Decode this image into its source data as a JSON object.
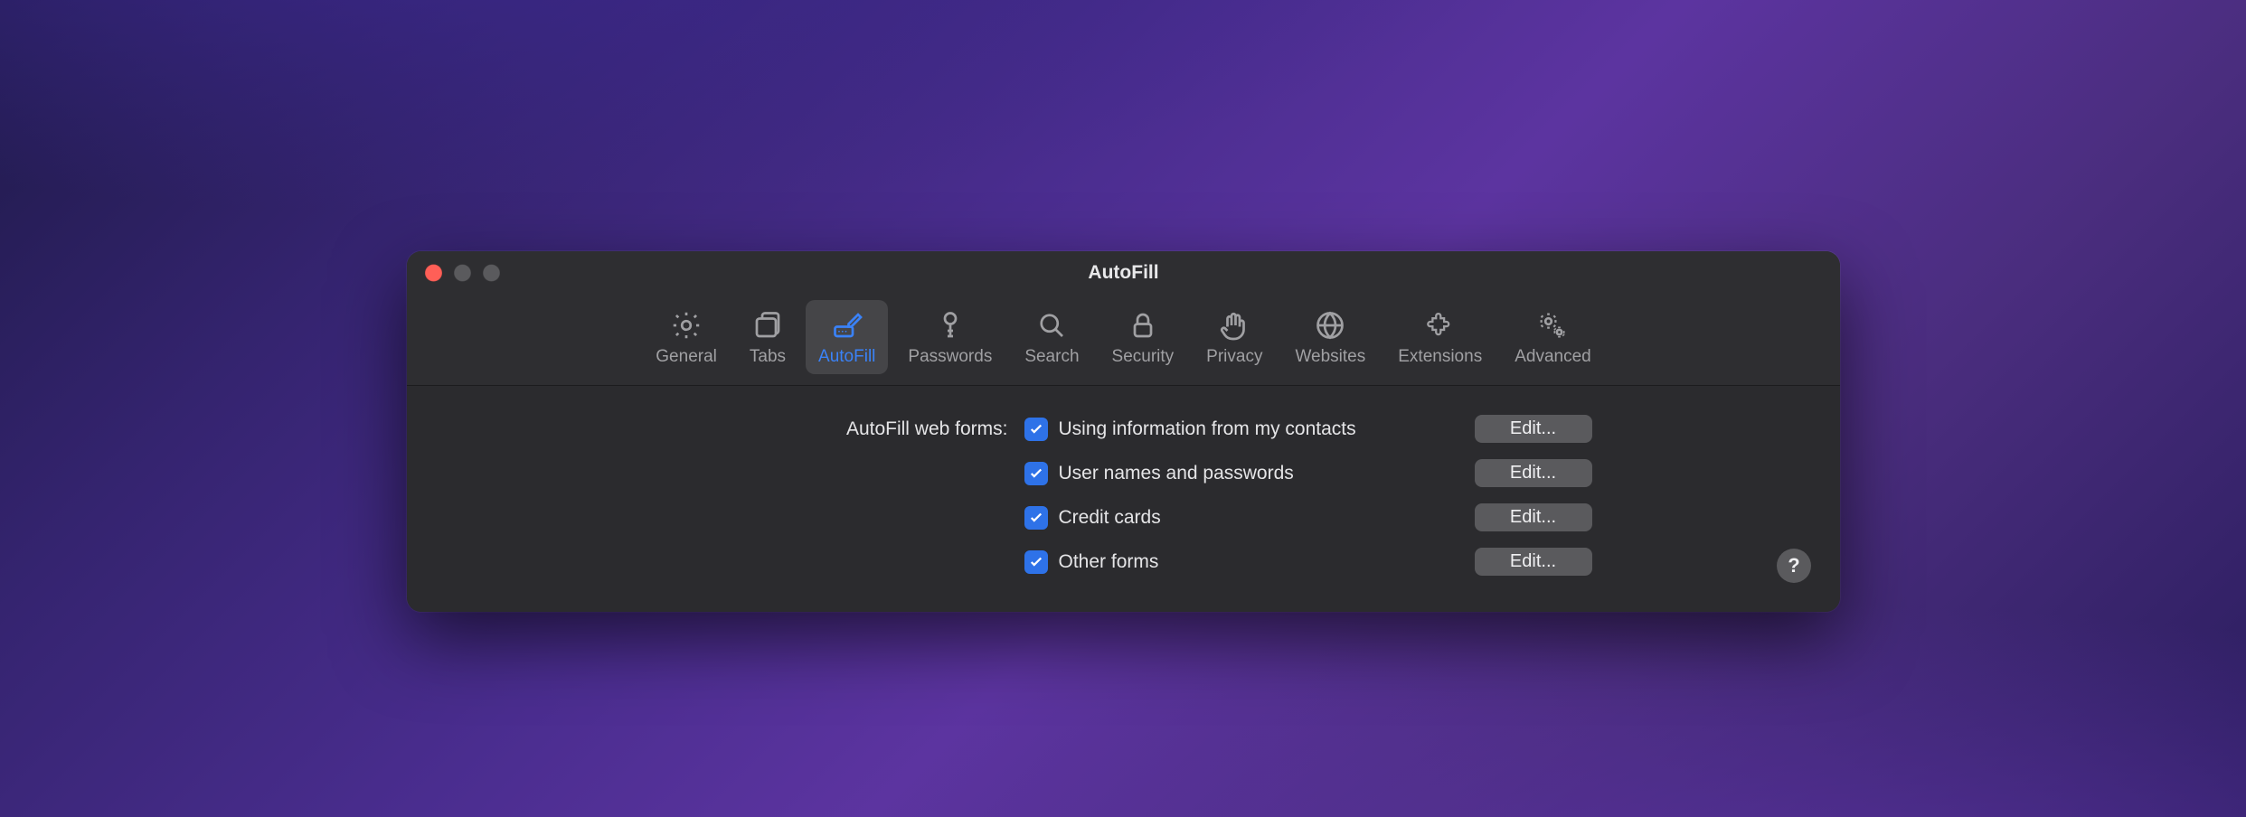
{
  "window": {
    "title": "AutoFill"
  },
  "toolbar": {
    "general": {
      "label": "General"
    },
    "tabs": {
      "label": "Tabs"
    },
    "autofill": {
      "label": "AutoFill",
      "active": true
    },
    "passwords": {
      "label": "Passwords"
    },
    "search": {
      "label": "Search"
    },
    "security": {
      "label": "Security"
    },
    "privacy": {
      "label": "Privacy"
    },
    "websites": {
      "label": "Websites"
    },
    "extensions": {
      "label": "Extensions"
    },
    "advanced": {
      "label": "Advanced"
    }
  },
  "content": {
    "section_label": "AutoFill web forms:",
    "options": {
      "contacts": {
        "label": "Using information from my contacts",
        "checked": true,
        "edit": "Edit..."
      },
      "usernames": {
        "label": "User names and passwords",
        "checked": true,
        "edit": "Edit..."
      },
      "credit": {
        "label": "Credit cards",
        "checked": true,
        "edit": "Edit..."
      },
      "other": {
        "label": "Other forms",
        "checked": true,
        "edit": "Edit..."
      }
    }
  },
  "help": {
    "label": "?"
  }
}
